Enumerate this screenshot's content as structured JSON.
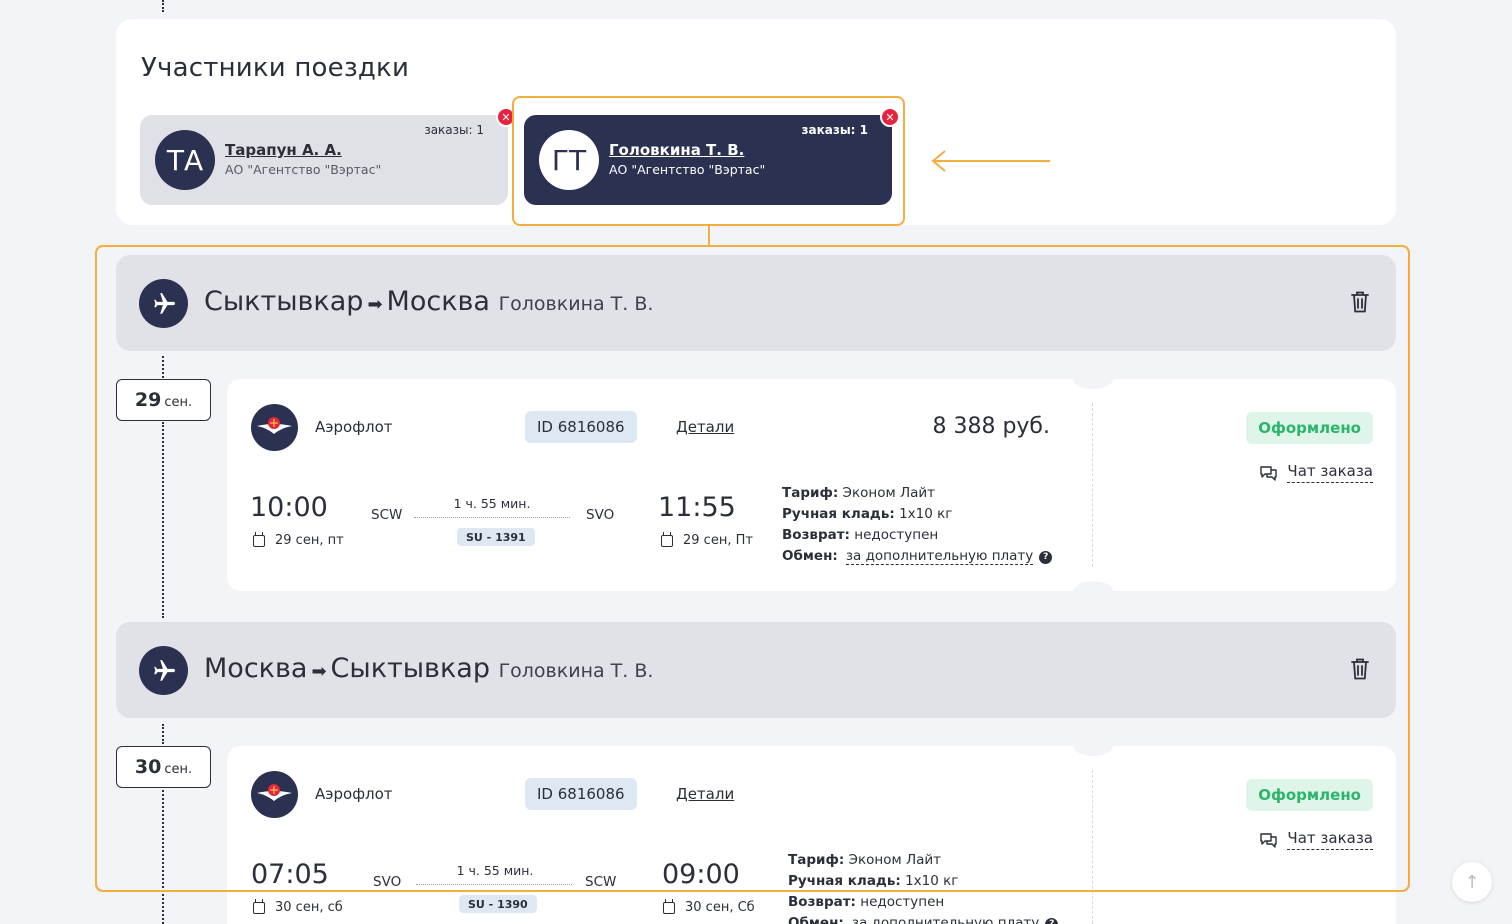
{
  "participants": {
    "title": "Участники поездки",
    "items": [
      {
        "initials": "ТА",
        "name": "Тарапун А. А.",
        "org": "АО \"Агентство \"Вэртас\"",
        "orders": "заказы: 1"
      },
      {
        "initials": "ГТ",
        "name": "Головкина Т. В.",
        "org": "АО \"Агентство \"Вэртас\"",
        "orders": "заказы: 1"
      }
    ]
  },
  "segments": [
    {
      "from": "Сыктывкар",
      "to": "Москва",
      "traveler": "Головкина Т. В.",
      "date_day": "29",
      "date_month": "сен.",
      "airline": "Аэрофлот",
      "order_id": "ID 6816086",
      "details_label": "Детали",
      "price": "8 388 руб.",
      "dep_time": "10:00",
      "dep_code": "SCW",
      "dep_date": "29 сен, пт",
      "duration": "1 ч. 55 мин.",
      "flight_number": "SU - 1391",
      "arr_code": "SVO",
      "arr_time": "11:55",
      "arr_date": "29 сен, Пт",
      "tariff_label": "Тариф:",
      "tariff_value": "Эконом Лайт",
      "baggage_label": "Ручная кладь:",
      "baggage_value": "1х10 кг",
      "refund_label": "Возврат:",
      "refund_value": "недоступен",
      "exchange_label": "Обмен:",
      "exchange_value": "за дополнительную плату",
      "status": "Оформлено",
      "chat_label": "Чат заказа"
    },
    {
      "from": "Москва",
      "to": "Сыктывкар",
      "traveler": "Головкина Т. В.",
      "date_day": "30",
      "date_month": "сен.",
      "airline": "Аэрофлот",
      "order_id": "ID 6816086",
      "details_label": "Детали",
      "dep_time": "07:05",
      "dep_code": "SVO",
      "dep_date": "30 сен, сб",
      "duration": "1 ч. 55 мин.",
      "flight_number": "SU - 1390",
      "arr_code": "SCW",
      "arr_time": "09:00",
      "arr_date": "30 сен, Сб",
      "tariff_label": "Тариф:",
      "tariff_value": "Эконом Лайт",
      "baggage_label": "Ручная кладь:",
      "baggage_value": "1х10 кг",
      "refund_label": "Возврат:",
      "refund_value": "недоступен",
      "exchange_label": "Обмен:",
      "exchange_value": "за дополнительную плату",
      "status": "Оформлено",
      "chat_label": "Чат заказа"
    }
  ],
  "colors": {
    "accent_dark": "#2b3150",
    "highlight": "#f4ae3f",
    "status_green": "#2bb56b",
    "remove_red": "#e8233d"
  }
}
